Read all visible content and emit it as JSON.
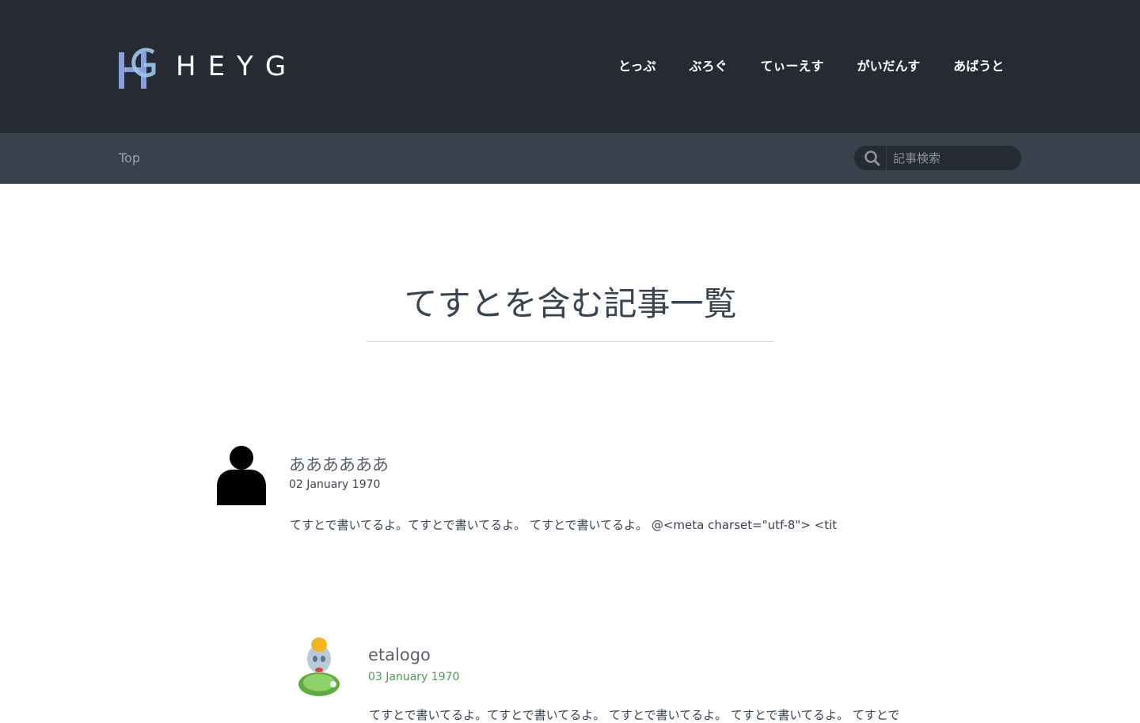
{
  "header": {
    "logo_text": "HEYG",
    "nav": [
      {
        "label": "とっぷ"
      },
      {
        "label": "ぶろぐ"
      },
      {
        "label": "てぃーえす"
      },
      {
        "label": "がいだんす"
      },
      {
        "label": "あばうと"
      }
    ]
  },
  "subbar": {
    "breadcrumb": "Top",
    "search": {
      "placeholder": "記事検索",
      "value": ""
    }
  },
  "main": {
    "title": "てすとを含む記事一覧"
  },
  "posts": [
    {
      "author": "ああああああ",
      "date": "02 January 1970",
      "excerpt": "てすとで書いてるよ。てすとで書いてるよ。 てすとで書いてるよ。 @<meta charset=\"utf-8\"> <tit",
      "avatar_icon": "user-silhouette-icon",
      "date_color": "#3a4450"
    },
    {
      "author": "etalogo",
      "date": "03 January 1970",
      "excerpt": "てすとで書いてるよ。てすとで書いてるよ。 てすとで書いてるよ。 てすとで書いてるよ。 てすとで",
      "avatar_icon": "mascot-avatar-icon",
      "date_color": "#4d9a57"
    }
  ],
  "colors": {
    "header_bg": "#252a33",
    "subbar_bg": "#38424d",
    "text": "#3a4450"
  }
}
